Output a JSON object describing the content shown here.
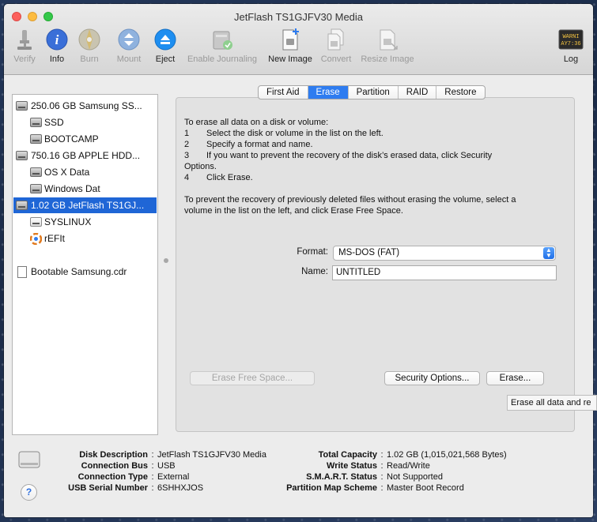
{
  "window": {
    "title": "JetFlash TS1GJFV30 Media"
  },
  "toolbar": {
    "verify": "Verify",
    "info": "Info",
    "burn": "Burn",
    "mount": "Mount",
    "eject": "Eject",
    "enable_journaling": "Enable Journaling",
    "new_image": "New Image",
    "convert": "Convert",
    "resize_image": "Resize Image",
    "log": "Log",
    "log_icon_text_1": "WARNI",
    "log_icon_text_2": "AY7:36"
  },
  "sidebar": {
    "items": [
      {
        "label": "250.06 GB Samsung SS..."
      },
      {
        "label": "SSD"
      },
      {
        "label": "BOOTCAMP"
      },
      {
        "label": "750.16 GB APPLE HDD..."
      },
      {
        "label": "OS X Data"
      },
      {
        "label": "Windows Dat"
      },
      {
        "label": "1.02 GB JetFlash TS1GJ..."
      },
      {
        "label": "SYSLINUX"
      },
      {
        "label": "rEFIt"
      },
      {
        "label": "Bootable Samsung.cdr"
      }
    ]
  },
  "tabs": [
    {
      "label": "First Aid"
    },
    {
      "label": "Erase"
    },
    {
      "label": "Partition"
    },
    {
      "label": "RAID"
    },
    {
      "label": "Restore"
    }
  ],
  "erase": {
    "intro": "To erase all data on a disk or volume:",
    "steps": [
      {
        "num": "1",
        "text": "Select the disk or volume in the list on the left."
      },
      {
        "num": "2",
        "text": "Specify a format and name."
      },
      {
        "num": "3",
        "text": "If you want to prevent the recovery of the disk’s erased data, click Security"
      },
      {
        "num": "",
        "text": "Options."
      },
      {
        "num": "4",
        "text": "Click Erase."
      }
    ],
    "free_space_note_1": "To prevent the recovery of previously deleted files without erasing the volume, select a",
    "free_space_note_2": "volume in the list on the left, and click Erase Free Space.",
    "format_label": "Format:",
    "format_value": "MS-DOS (FAT)",
    "name_label": "Name:",
    "name_value": "UNTITLED",
    "erase_free_space_button": "Erase Free Space...",
    "security_options_button": "Security Options...",
    "erase_button": "Erase...",
    "tooltip": "Erase all data and re"
  },
  "disk_info": {
    "left": [
      {
        "key": "Disk Description",
        "value": "JetFlash TS1GJFV30 Media"
      },
      {
        "key": "Connection Bus",
        "value": "USB"
      },
      {
        "key": "Connection Type",
        "value": "External"
      },
      {
        "key": "USB Serial Number",
        "value": "6SHHXJOS"
      }
    ],
    "right": [
      {
        "key": "Total Capacity",
        "value": "1.02 GB (1,015,021,568 Bytes)"
      },
      {
        "key": "Write Status",
        "value": "Read/Write"
      },
      {
        "key": "S.M.A.R.T. Status",
        "value": "Not Supported"
      },
      {
        "key": "Partition Map Scheme",
        "value": "Master Boot Record"
      }
    ],
    "separator": ":"
  },
  "help": "?",
  "colors": {
    "selection": "#1f66d6",
    "active_tab": "#2e7cf0",
    "info_icon": "#3a6fd8",
    "eject_icon": "#1e8ef0"
  }
}
